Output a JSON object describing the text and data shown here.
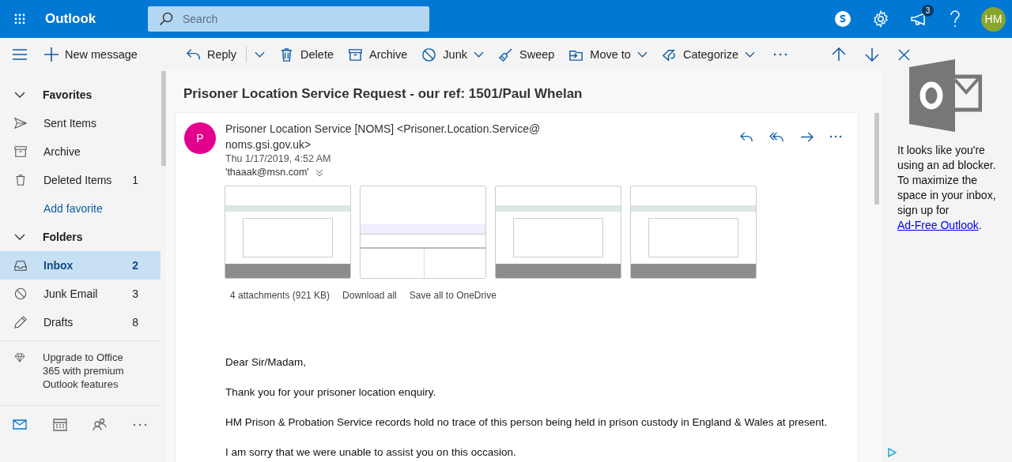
{
  "header": {
    "app_name": "Outlook",
    "search": {
      "placeholder": "Search"
    },
    "notification_count": "3",
    "avatar_initials": "HM"
  },
  "toolbar": {
    "new_message": "New message",
    "actions": [
      {
        "kind": "reply",
        "label": "Reply",
        "dropdown": true
      },
      {
        "kind": "delete",
        "label": "Delete",
        "dropdown": false
      },
      {
        "kind": "archive",
        "label": "Archive",
        "dropdown": false
      },
      {
        "kind": "junk",
        "label": "Junk",
        "dropdown": true
      },
      {
        "kind": "sweep",
        "label": "Sweep",
        "dropdown": false
      },
      {
        "kind": "move",
        "label": "Move to",
        "dropdown": true
      },
      {
        "kind": "categorize",
        "label": "Categorize",
        "dropdown": true
      }
    ]
  },
  "sidebar": {
    "sections": [
      {
        "title": "Favorites",
        "expanded": true,
        "items": [
          {
            "kind": "sent",
            "label": "Sent Items",
            "selected": false
          },
          {
            "kind": "archive",
            "label": "Archive",
            "selected": false
          },
          {
            "kind": "deleted",
            "label": "Deleted Items",
            "count": "1",
            "selected": false
          },
          {
            "kind": "link",
            "label": "Add favorite",
            "selected": false
          }
        ]
      },
      {
        "title": "Folders",
        "expanded": true,
        "items": [
          {
            "kind": "inbox",
            "label": "Inbox",
            "count": "2",
            "selected": true
          },
          {
            "kind": "junk",
            "label": "Junk Email",
            "count": "3",
            "selected": false
          },
          {
            "kind": "drafts",
            "label": "Drafts",
            "count": "8",
            "selected": false
          }
        ]
      }
    ],
    "upgrade": "Upgrade to Office 365 with premium Outlook features",
    "bottom_nav": [
      {
        "kind": "mail",
        "selected": true
      },
      {
        "kind": "calendar",
        "selected": false
      },
      {
        "kind": "people",
        "selected": false
      },
      {
        "kind": "more",
        "selected": false
      }
    ]
  },
  "message": {
    "subject": "Prisoner Location Service Request - our ref: 1501/Paul Whelan",
    "avatar_letter": "P",
    "sender": "Prisoner Location Service [NOMS] <Prisoner.Location.Service@ noms.gsi.gov.uk>",
    "date": "Thu 1/17/2019, 4:52 AM",
    "to": "'thaaak@msn.com'",
    "attachments": [
      {
        "kind": "web-page"
      },
      {
        "kind": "web-table"
      },
      {
        "kind": "web-page"
      },
      {
        "kind": "web-page"
      }
    ],
    "attachment_summary": "4 attachments (921 KB)",
    "download_all": "Download all",
    "save_all": "Save all to OneDrive",
    "body": [
      "Dear Sir/Madam,",
      "Thank you for your prisoner location enquiry.",
      "HM Prison & Probation Service records hold no trace of this person being held in prison custody in England & Wales at present.",
      "I am sorry that we were unable to assist you on this occasion."
    ]
  },
  "ad": {
    "text": "It looks like you're using an ad blocker. To maximize the space in your inbox, sign up for",
    "link": "Ad-Free Outlook",
    "end": "."
  }
}
